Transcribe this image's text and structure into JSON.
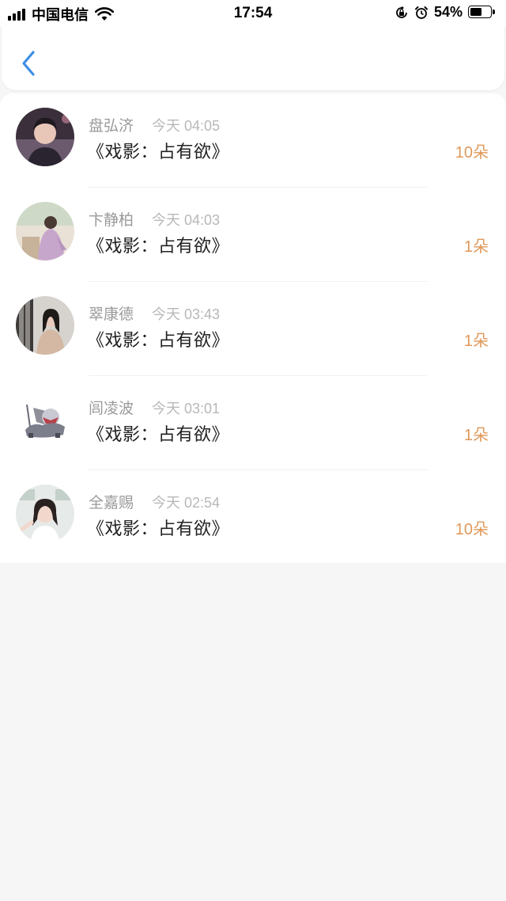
{
  "status_bar": {
    "carrier": "中国电信",
    "time": "17:54",
    "battery_pct": "54%",
    "icons": [
      "signal-icon",
      "wifi-icon",
      "orientation-lock-icon",
      "alarm-icon",
      "battery-icon"
    ]
  },
  "nav": {
    "back_icon": "chevron-left-icon",
    "accent_color": "#3d8ee6"
  },
  "list": {
    "items": [
      {
        "name": "盘弘济",
        "time": "今天 04:05",
        "title": "《戏影：占有欲》",
        "amount": "10朵"
      },
      {
        "name": "卞静柏",
        "time": "今天 04:03",
        "title": "《戏影：占有欲》",
        "amount": "1朵"
      },
      {
        "name": "翠康德",
        "time": "今天 03:43",
        "title": "《戏影：占有欲》",
        "amount": "1朵"
      },
      {
        "name": "闾凌波",
        "time": "今天 03:01",
        "title": "《戏影：占有欲》",
        "amount": "1朵"
      },
      {
        "name": "全嘉赐",
        "time": "今天 02:54",
        "title": "《戏影：占有欲》",
        "amount": "10朵"
      }
    ]
  },
  "colors": {
    "amount": "#e0995a",
    "name": "#9a9a9a",
    "time": "#b8b8b8",
    "title": "#222222",
    "background": "#f6f6f6"
  }
}
